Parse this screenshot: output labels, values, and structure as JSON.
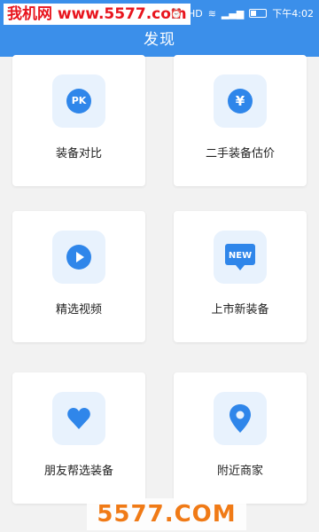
{
  "status_bar": {
    "watermark": "我机网 www.5577.com",
    "time": "下午4:02"
  },
  "header": {
    "title": "发现"
  },
  "cards": [
    {
      "label": "装备对比",
      "icon": "pk-icon",
      "glyph": "PK"
    },
    {
      "label": "二手装备估价",
      "icon": "yen-icon",
      "glyph": "¥"
    },
    {
      "label": "精选视频",
      "icon": "play-icon",
      "glyph": ""
    },
    {
      "label": "上市新装备",
      "icon": "new-icon",
      "glyph": "NEW"
    },
    {
      "label": "朋友帮选装备",
      "icon": "heart-icon",
      "glyph": ""
    },
    {
      "label": "附近商家",
      "icon": "location-icon",
      "glyph": ""
    }
  ],
  "footer": {
    "watermark": "5577.COM"
  },
  "colors": {
    "primary": "#3b8fea",
    "icon_blue": "#2f86ea",
    "icon_tile_bg": "#e8f2fd",
    "page_bg": "#f2f2f2",
    "watermark_red": "#e8151e",
    "watermark_orange": "#f07a16"
  }
}
